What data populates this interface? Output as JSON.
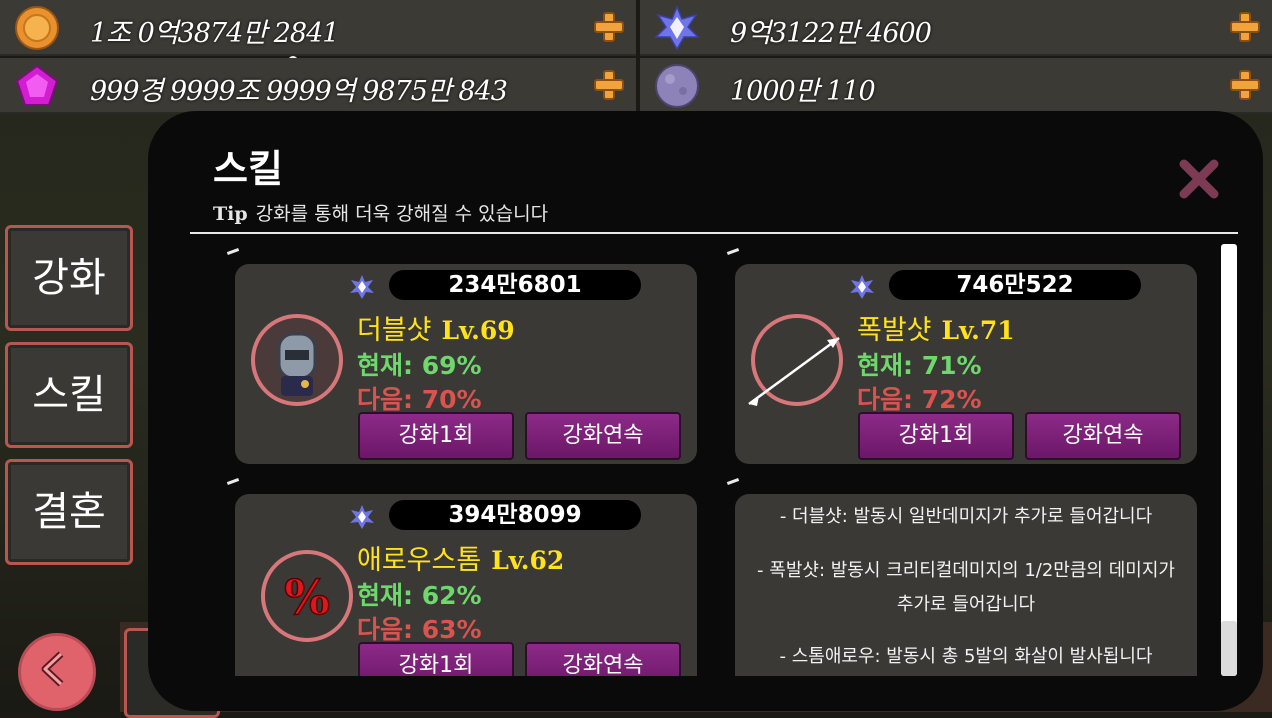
{
  "currencies": [
    {
      "icon": "gold-coin-icon",
      "value": "1조 0억3874만 2841"
    },
    {
      "icon": "star-crystal-icon",
      "value": "9억3122만 4600"
    },
    {
      "icon": "pink-gem-icon",
      "value": "999경 9999조 9999억 9875만 843"
    },
    {
      "icon": "moon-orb-icon",
      "value": "1000만 110"
    }
  ],
  "side_menu": {
    "upgrade": "강화",
    "skill": "스킬",
    "marriage": "결혼"
  },
  "panel": {
    "title": "스킬",
    "tip_label": "Tip",
    "tip_text": "강화를 통해 더욱 강해질 수 있습니다"
  },
  "skills": [
    {
      "cost": "234만6801",
      "name": "더블샷",
      "level": "Lv.69",
      "current": "현재: 69%",
      "next": "다음: 70%",
      "btn_once": "강화1회",
      "btn_repeat": "강화연속"
    },
    {
      "cost": "746만522",
      "name": "폭발샷",
      "level": "Lv.71",
      "current": "현재: 71%",
      "next": "다음: 72%",
      "btn_once": "강화1회",
      "btn_repeat": "강화연속"
    },
    {
      "cost": "394만8099",
      "name": "애로우스톰",
      "level": "Lv.62",
      "current": "현재: 62%",
      "next": "다음: 63%",
      "btn_once": "강화1회",
      "btn_repeat": "강화연속"
    }
  ],
  "descriptions": [
    "- 더블샷: 발동시 일반데미지가 추가로 들어갑니다",
    "- 폭발샷: 발동시 크리티컬데미지의 1/2만큼의 데미지가",
    "추가로 들어갑니다",
    "- 스톰애로우: 발동시 총 5발의 화살이 발사됩니다"
  ],
  "colors": {
    "panel": "#0a0a0a",
    "card": "#3a3936",
    "button": "#7a1f76",
    "name": "#ffe21a",
    "current": "#6fd86d",
    "next": "#d9534f",
    "accent_border": "#b8574f"
  }
}
